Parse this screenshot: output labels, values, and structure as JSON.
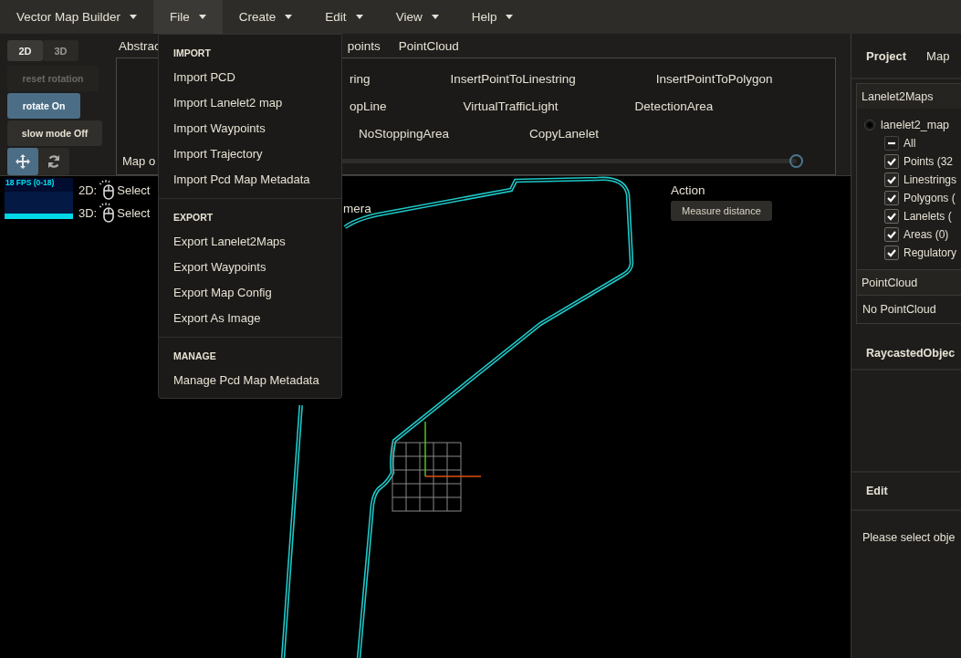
{
  "menubar": [
    {
      "label": "Vector Map Builder",
      "selected": false
    },
    {
      "label": "File",
      "selected": true
    },
    {
      "label": "Create",
      "selected": false
    },
    {
      "label": "Edit",
      "selected": false
    },
    {
      "label": "View",
      "selected": false
    },
    {
      "label": "Help",
      "selected": false
    }
  ],
  "view_modes": [
    {
      "label": "2D",
      "selected": true
    },
    {
      "label": "3D",
      "selected": false
    }
  ],
  "toggles": [
    {
      "label": "reset rotation",
      "on": false,
      "disabled": true
    },
    {
      "label": "rotate On",
      "on": true,
      "disabled": false
    },
    {
      "label": "slow mode Off",
      "on": false,
      "disabled": false
    }
  ],
  "tool_modes": [
    {
      "kind": "move",
      "selected": true
    },
    {
      "kind": "rotate",
      "selected": false
    }
  ],
  "tabs": [
    "Abstrac",
    "points",
    "PointCloud"
  ],
  "tool_rows": [
    [
      "ring",
      "InsertPointToLinestring",
      "InsertPointToPolygon"
    ],
    [
      "opLine",
      "VirtualTrafficLight",
      "DetectionArea"
    ],
    [
      "NoStoppingArea",
      "CopyLanelet"
    ]
  ],
  "map_opacity": {
    "label": "Map o",
    "level": 1
  },
  "viewport": {
    "fps": "18 FPS (0-18)",
    "hints": [
      {
        "prefix": "2D:",
        "text": "Select"
      },
      {
        "prefix": "3D:",
        "text": "Select"
      }
    ],
    "hint_tail": "mera",
    "action_label": "Action",
    "action_button": "Measure distance"
  },
  "file_menu": [
    {
      "heading": "IMPORT",
      "items": [
        "Import PCD",
        "Import Lanelet2 map",
        "Import Waypoints",
        "Import Trajectory",
        "Import Pcd Map Metadata"
      ]
    },
    {
      "heading": "EXPORT",
      "items": [
        "Export Lanelet2Maps",
        "Export Waypoints",
        "Export Map Config",
        "Export As Image"
      ]
    },
    {
      "heading": "MANAGE",
      "items": [
        "Manage Pcd Map Metadata"
      ]
    }
  ],
  "side_tabs": [
    {
      "label": "Project",
      "selected": true
    },
    {
      "label": "Map",
      "selected": false
    }
  ],
  "lanelet_section": {
    "title": "Lanelet2Maps",
    "map": {
      "label": "lanelet2_map",
      "selected": true
    },
    "layers": [
      {
        "label": "All",
        "checked": false,
        "indeterminate": true
      },
      {
        "label": "Points (32",
        "checked": true,
        "indeterminate": false
      },
      {
        "label": "Linestrings",
        "checked": true,
        "indeterminate": false
      },
      {
        "label": "Polygons (",
        "checked": true,
        "indeterminate": false
      },
      {
        "label": "Lanelets (",
        "checked": true,
        "indeterminate": false
      },
      {
        "label": "Areas (0)",
        "checked": true,
        "indeterminate": false
      },
      {
        "label": "Regulatory",
        "checked": true,
        "indeterminate": false
      }
    ]
  },
  "pointcloud_section": {
    "title": "PointCloud",
    "text": "No PointCloud"
  },
  "raycast_title": "RaycastedObjec",
  "edit_section": {
    "title": "Edit",
    "text": "Please select obje"
  }
}
